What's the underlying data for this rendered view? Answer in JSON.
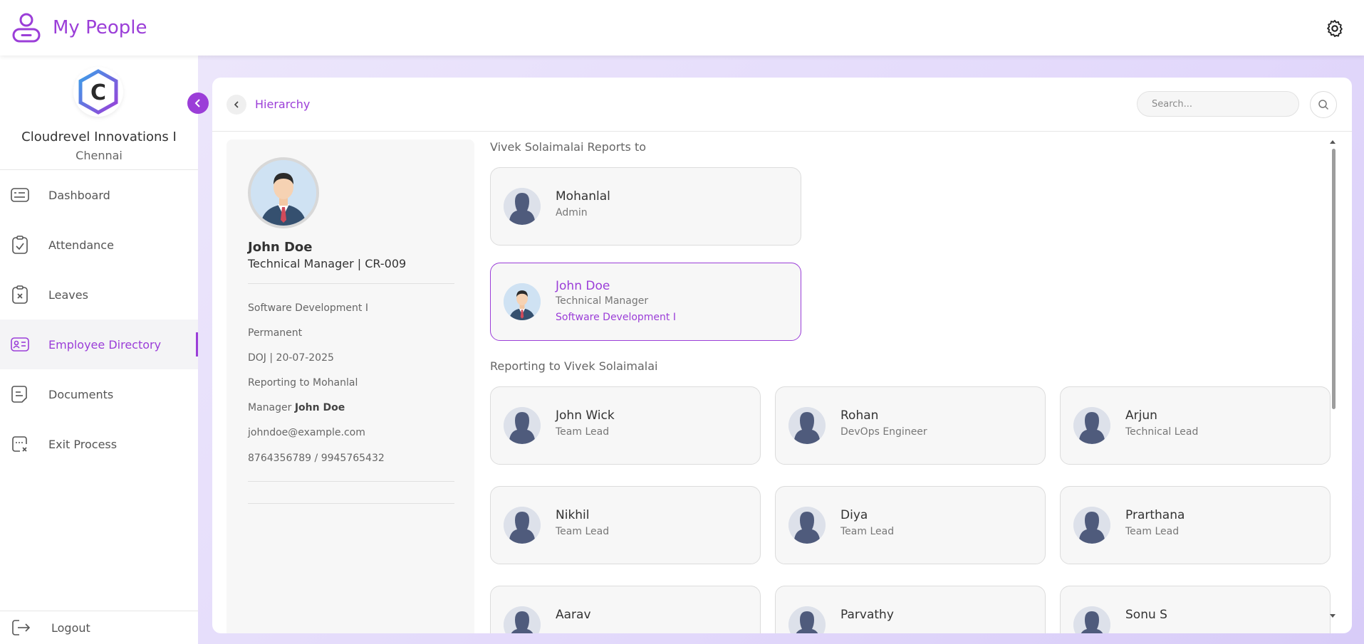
{
  "app": {
    "title": "My People"
  },
  "sidebar": {
    "org_name": "Cloudrevel Innovations I",
    "org_city": "Chennai",
    "logo_letter": "C",
    "items": [
      {
        "label": "Dashboard",
        "icon": "dashboard-icon"
      },
      {
        "label": "Attendance",
        "icon": "attendance-icon"
      },
      {
        "label": "Leaves",
        "icon": "leaves-icon"
      },
      {
        "label": "Employee Directory",
        "icon": "employee-directory-icon",
        "active": true
      },
      {
        "label": "Documents",
        "icon": "documents-icon"
      },
      {
        "label": "Exit Process",
        "icon": "exit-process-icon"
      }
    ],
    "logout_label": "Logout"
  },
  "header": {
    "breadcrumb": "Hierarchy",
    "search_placeholder": "Search..."
  },
  "profile": {
    "name": "John Doe",
    "role": "Technical Manager | CR-009",
    "department": "Software Development I",
    "employment_type": "Permanent",
    "doj": "DOJ | 20-07-2025",
    "reporting_to": "Reporting to Mohanlal",
    "manager_prefix": "Manager",
    "manager_name": "John Doe",
    "email": "johndoe@example.com",
    "phones": "8764356789 / 9945765432"
  },
  "hierarchy": {
    "reports_to_title": "Vivek Solaimalai Reports to",
    "manager": {
      "name": "Mohanlal",
      "role": "Admin"
    },
    "selected": {
      "name": "John Doe",
      "role": "Technical Manager",
      "department": "Software Development I"
    },
    "reportees_title": "Reporting to Vivek Solaimalai",
    "reportees": [
      {
        "name": "John Wick",
        "role": "Team Lead"
      },
      {
        "name": "Rohan",
        "role": "DevOps Engineer"
      },
      {
        "name": "Arjun",
        "role": "Technical Lead"
      },
      {
        "name": "Nikhil",
        "role": "Team Lead"
      },
      {
        "name": "Diya",
        "role": "Team Lead"
      },
      {
        "name": "Prarthana",
        "role": "Team Lead"
      },
      {
        "name": "Aarav",
        "role": ""
      },
      {
        "name": "Parvathy",
        "role": ""
      },
      {
        "name": "Sonu S",
        "role": ""
      }
    ]
  },
  "colors": {
    "accent": "#9b3ed8",
    "background_gradient": "#e2d8fb"
  }
}
